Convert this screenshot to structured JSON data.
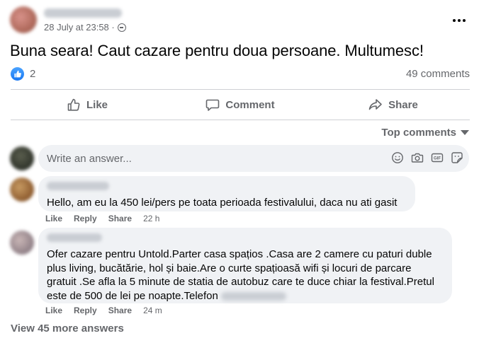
{
  "post": {
    "timestamp": "28 July at 23:58 ·",
    "text": "Buna seara! Caut cazare pentru doua persoane. Multumesc!",
    "reactions_count": "2",
    "comments_count": "49 comments"
  },
  "actions": {
    "like": "Like",
    "comment": "Comment",
    "share": "Share"
  },
  "sort_label": "Top comments",
  "composer": {
    "placeholder": "Write an answer..."
  },
  "comments": [
    {
      "text": "Hello, am eu la 450 lei/pers pe toata perioada festivalului, daca nu ati gasit",
      "like": "Like",
      "reply": "Reply",
      "share": "Share",
      "time": "22 h"
    },
    {
      "text": "Ofer cazare pentru Untold.Parter casa spațios .Casa are 2 camere cu paturi duble plus living, bucătărie, hol și baie.Are o curte spațioasă wifi și locuri de parcare gratuit .Se afla la 5 minute de statia de autobuz care te duce chiar la festival.Pretul este de 500 de lei pe noapte.Telefon",
      "like": "Like",
      "reply": "Reply",
      "share": "Share",
      "time": "24 m"
    }
  ],
  "view_more": "View 45 more answers",
  "icons": {
    "like_badge": "thumbs-up-icon",
    "globe": "globe-icon",
    "more": "more-options-icon",
    "composer": [
      "emoji-icon",
      "camera-icon",
      "gif-icon",
      "sticker-icon"
    ]
  },
  "colors": {
    "brand_blue": "#1877f2",
    "secondary_text": "#65676b",
    "bubble_bg": "#f0f2f5"
  }
}
